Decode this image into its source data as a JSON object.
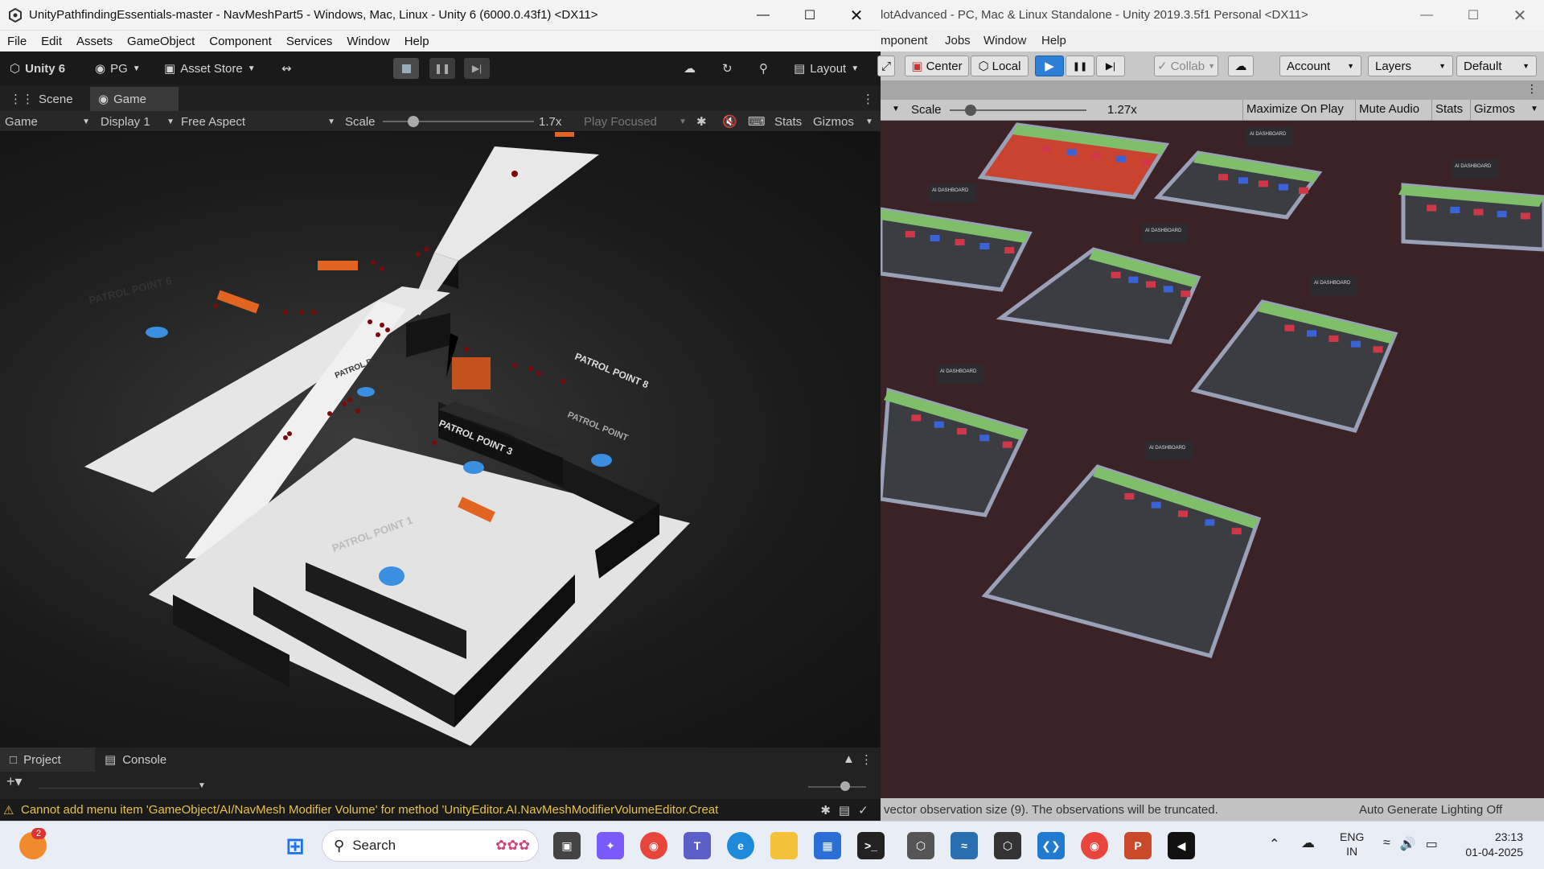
{
  "unity6": {
    "title": "UnityPathfindingEssentials-master - NavMeshPart5 - Windows, Mac, Linux - Unity 6 (6000.0.43f1) <DX11>",
    "menu": [
      "File",
      "Edit",
      "Assets",
      "GameObject",
      "Component",
      "Services",
      "Window",
      "Help"
    ],
    "toolbar": {
      "brand": "Unity 6",
      "account": "PG",
      "asset_store": "Asset Store",
      "layout": "Layout"
    },
    "tabs": {
      "scene": "Scene",
      "game": "Game"
    },
    "gamebar": {
      "mode": "Game",
      "display": "Display 1",
      "aspect": "Free Aspect",
      "scale_label": "Scale",
      "scale_value": "1.7x",
      "play_focused": "Play Focused",
      "stats": "Stats",
      "gizmos": "Gizmos"
    },
    "scale_level": 0.2,
    "scene_labels": {
      "p6": "PATROL POINT 6",
      "p7": "PATROL POINT 7",
      "p3": "PATROL POINT 3",
      "p1": "PATROL POINT 1",
      "p8": "PATROL POINT 8",
      "pr": "PATROL POINT"
    },
    "bottom_tabs": {
      "project": "Project",
      "console": "Console"
    },
    "status": "Cannot add menu item 'GameObject/AI/NavMesh Modifier Volume' for method 'UnityEditor.AI.NavMeshModifierVolumeEditor.Creat"
  },
  "unity2019": {
    "title": "lotAdvanced - PC, Mac & Linux Standalone - Unity 2019.3.5f1 Personal <DX11>",
    "menu": [
      "mponent",
      "Jobs",
      "Window",
      "Help"
    ],
    "toolbar": {
      "center": "Center",
      "local": "Local",
      "collab": "Collab",
      "account": "Account",
      "layers": "Layers",
      "layout": "Default"
    },
    "gamebar": {
      "scale_label": "Scale",
      "scale_value": "1.27x",
      "maximize": "Maximize On Play",
      "mute": "Mute Audio",
      "stats": "Stats",
      "gizmos": "Gizmos"
    },
    "scale_level": 0.15,
    "dashboard_label": "AI DASHBOARD",
    "status": "vector observation size (9). The observations will be truncated.",
    "lighting": "Auto Generate Lighting Off"
  },
  "taskbar": {
    "search": "Search",
    "notification_count": "2",
    "lang": "ENG",
    "region": "IN",
    "time": "23:13",
    "date": "01-04-2025"
  },
  "colors": {
    "unity6_bg": "#191919",
    "unity2019_bg": "#c2c2c2",
    "play_active": "#2d7fd6",
    "warning": "#e8c24a",
    "lot_background": "#3a2226"
  }
}
